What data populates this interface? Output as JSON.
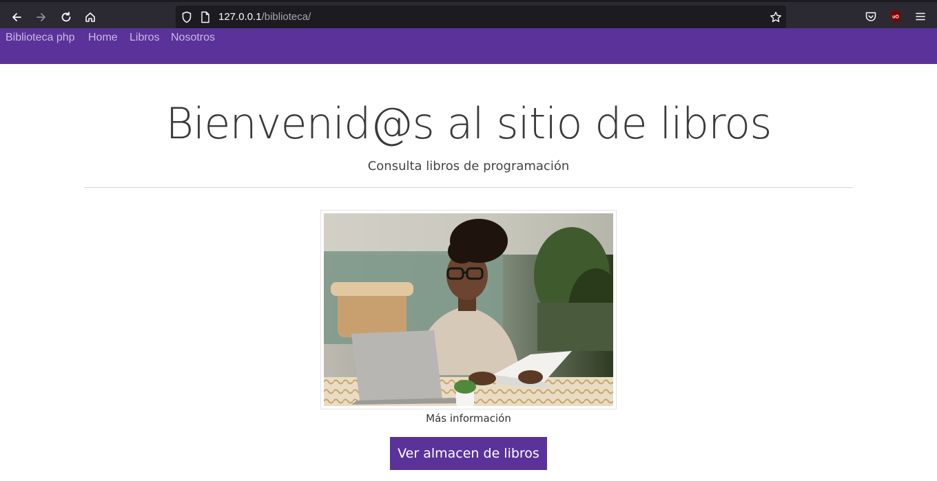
{
  "browser": {
    "url_host": "127.0.0.1",
    "url_path": "/biblioteca/"
  },
  "nav": {
    "brand": "Biblioteca php",
    "items": [
      "Home",
      "Libros",
      "Nosotros"
    ]
  },
  "hero": {
    "title": "Bienvenid@s al sitio de libros",
    "subtitle": "Consulta libros de programación"
  },
  "image": {
    "caption": "Más información"
  },
  "cta": {
    "label": "Ver almacen de libros"
  },
  "colors": {
    "accent": "#5b3299",
    "chrome": "#2b2a33"
  }
}
